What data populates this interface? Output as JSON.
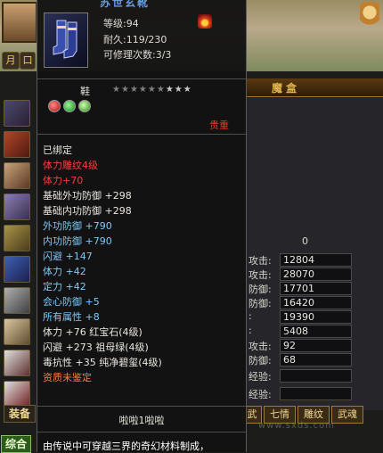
{
  "tooltip": {
    "title": "苏世玄靴",
    "level": "等级:94",
    "durability": "耐久:119/230",
    "repair": "可修理次数:3/3",
    "type": "鞋",
    "stars": 8,
    "stars_max": 10,
    "rarity": "贵重",
    "attributes": [
      {
        "text": "已绑定",
        "color": "white"
      },
      {
        "text": "体力雕纹4级",
        "color": "red"
      },
      {
        "text": "体力+70",
        "color": "red"
      },
      {
        "text": "基础外功防御 +298",
        "color": "white"
      },
      {
        "text": "基础内功防御 +298",
        "color": "white"
      },
      {
        "text": "外功防御 +790",
        "color": "green"
      },
      {
        "text": "内功防御 +790",
        "color": "green"
      },
      {
        "text": "闪避 +147",
        "color": "green"
      },
      {
        "text": "体力 +42",
        "color": "green"
      },
      {
        "text": "定力 +42",
        "color": "green"
      },
      {
        "text": "会心防御 +5",
        "color": "green"
      },
      {
        "text": "所有属性 +8",
        "color": "green"
      },
      {
        "text": "体力 +76 红宝石(4级)",
        "color": "white"
      },
      {
        "text": "闪避 +273 祖母绿(4级)",
        "color": "white"
      },
      {
        "text": "毒抗性 +35 纯净碧玺(4级)",
        "color": "white"
      },
      {
        "text": "资质未鉴定",
        "color": "orange"
      }
    ],
    "owner": "啦啦1啦啦",
    "description": "由传说中可穿越三界的奇幻材料制成，"
  },
  "panel": {
    "header": "魔盒",
    "stats": [
      {
        "label": "",
        "value": "0",
        "plain": true
      },
      {
        "label": "攻击:",
        "value": "12804"
      },
      {
        "label": "攻击:",
        "value": "28070"
      },
      {
        "label": "防御:",
        "value": "17701"
      },
      {
        "label": "防御:",
        "value": "16420"
      },
      {
        "label": ":",
        "value": "19390"
      },
      {
        "label": ":",
        "value": "5408"
      },
      {
        "label": "攻击:",
        "value": "92"
      },
      {
        "label": "防御:",
        "value": "68"
      },
      {
        "label": "经验:",
        "value": ""
      },
      {
        "label": "经验:",
        "value": ""
      }
    ],
    "buttons": [
      "武",
      "七情",
      "雕纹",
      "武魂"
    ]
  },
  "sidebar": {
    "btn1": "月",
    "btn2": "口",
    "equip_tab": "装备",
    "combo_tab": "综合"
  },
  "watermark": "www.sxds.com"
}
